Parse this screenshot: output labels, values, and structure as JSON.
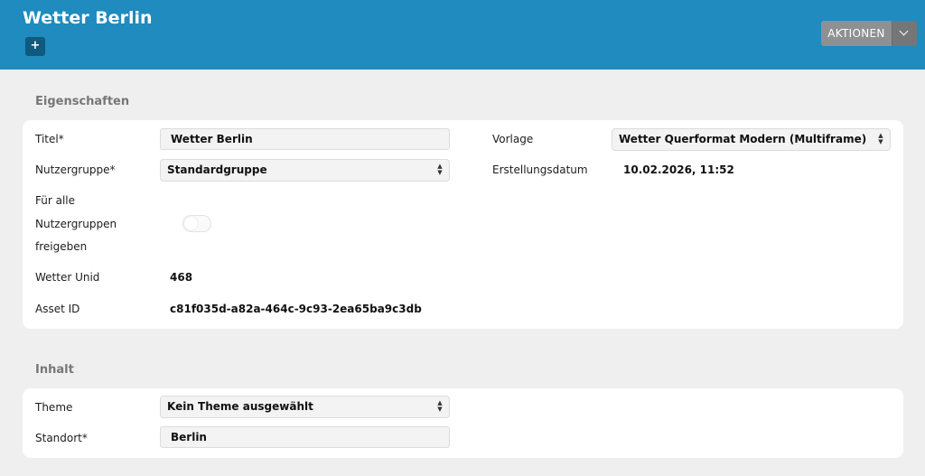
{
  "header": {
    "title": "Wetter Berlin",
    "add_label": "+",
    "actions_label": "AKTIONEN"
  },
  "properties": {
    "section_title": "Eigenschaften",
    "title_label": "Titel*",
    "title_value": "Wetter Berlin",
    "user_group_label": "Nutzergruppe*",
    "user_group_value": "Standardgruppe",
    "share_label_1": "Für alle",
    "share_label_2": "Nutzergruppen",
    "share_label_3": "freigeben",
    "share_enabled": false,
    "weather_unid_label": "Wetter Unid",
    "weather_unid_value": "468",
    "asset_id_label": "Asset ID",
    "asset_id_value": "c81f035d-a82a-464c-9c93-2ea65ba9c3db",
    "template_label": "Vorlage",
    "template_value": "Wetter Querformat Modern (Multiframe)",
    "created_label": "Erstellungsdatum",
    "created_value": "10.02.2026, 11:52"
  },
  "content": {
    "section_title": "Inhalt",
    "theme_label": "Theme",
    "theme_value": "Kein Theme ausgewählt",
    "location_label": "Standort*",
    "location_value": "Berlin"
  },
  "icons": {
    "select_arrows": "⌃⌄",
    "actions_dropdown": "chevron-down-icon"
  },
  "colors": {
    "header": "#1f8bbf",
    "add_button": "#0f5a7e",
    "actions_button": "#8f9092"
  }
}
